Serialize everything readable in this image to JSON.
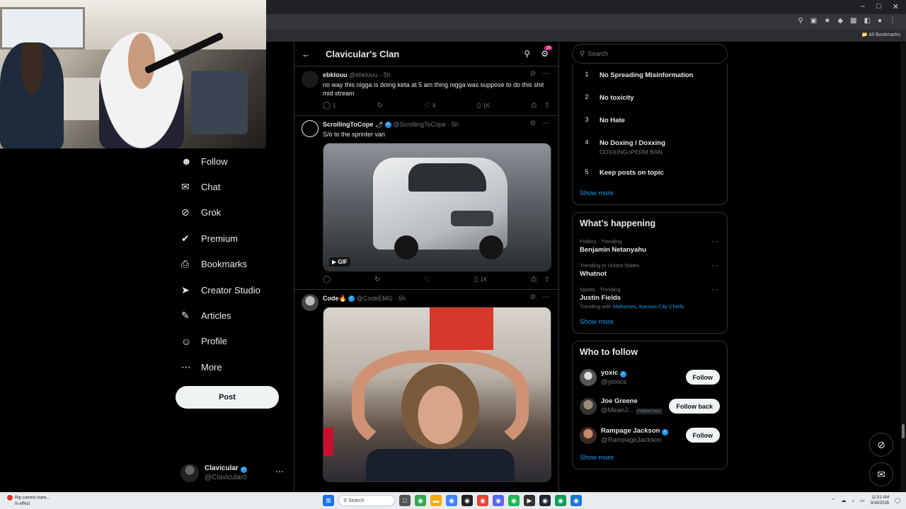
{
  "browser": {
    "bookmarks_all": "All Bookmarks"
  },
  "nav": {
    "items": [
      {
        "label": "Follow",
        "icon": "follow-icon"
      },
      {
        "label": "Chat",
        "icon": "chat-icon"
      },
      {
        "label": "Grok",
        "icon": "grok-icon"
      },
      {
        "label": "Premium",
        "icon": "premium-icon"
      },
      {
        "label": "Bookmarks",
        "icon": "bookmark-icon"
      },
      {
        "label": "Creator Studio",
        "icon": "rocket-icon"
      },
      {
        "label": "Articles",
        "icon": "articles-icon"
      },
      {
        "label": "Profile",
        "icon": "profile-icon"
      },
      {
        "label": "More",
        "icon": "more-circle-icon"
      }
    ],
    "post_label": "Post",
    "account": {
      "name": "Clavicular",
      "handle": "@Clavicular0"
    }
  },
  "community": {
    "title": "Clavicular's Clan",
    "notif_badge": "19"
  },
  "tweets": [
    {
      "name": "ebklouu",
      "handle": "@ebklouu",
      "time": "· 5h",
      "text": "no way this nigga is doing keta at 5 am thing nigga was suppose to do this shit mid stream",
      "replies": "1",
      "likes": "6",
      "views": "1K"
    },
    {
      "name": "ScrollingToCope",
      "emoji": "🌶",
      "handle": "@ScrollingToCope",
      "time": "· 5h",
      "text": "S/o to the sprinter van",
      "media_badge": "GIF",
      "views": "1K"
    },
    {
      "name": "Code",
      "emoji": "🔥",
      "handle": "@CodeEMG",
      "time": "· 5h"
    }
  ],
  "right": {
    "search_placeholder": "Search",
    "rules": [
      {
        "num": "1",
        "title": "No Spreading Misinformation",
        "sub": ""
      },
      {
        "num": "2",
        "title": "No toxicity",
        "sub": ""
      },
      {
        "num": "3",
        "title": "No Hate",
        "sub": ""
      },
      {
        "num": "4",
        "title": "No Doxing / Doxxing",
        "sub": "DOXXING=PERM BAN"
      },
      {
        "num": "5",
        "title": "Keep posts on topic",
        "sub": ""
      }
    ],
    "show_more": "Show more",
    "happening_title": "What’s happening",
    "trends": [
      {
        "context": "Politics · Trending",
        "title": "Benjamin Netanyahu"
      },
      {
        "context": "Trending in United States",
        "title": "Whatnot"
      },
      {
        "context": "Sports · Trending",
        "title": "Justin Fields",
        "with_label": "Trending with",
        "with_links": "Mahomes, Kansas City Chiefs"
      }
    ],
    "wtf_title": "Who to follow",
    "wtf": [
      {
        "name": "yoxic",
        "handle": "@yoxics",
        "button": "Follow"
      },
      {
        "name": "Joe Greene",
        "handle": "@MeanJ...",
        "follows_you": "Follows you",
        "button": "Follow back"
      },
      {
        "name": "Rampage Jackson",
        "handle": "@RampageJackson",
        "button": "Follow"
      }
    ]
  },
  "taskbar": {
    "notif_line1": "Rip current stare...",
    "notif_line2": "In effect",
    "search": "Search",
    "time": "11:51 AM",
    "date": "3/16/2026"
  },
  "colors": {
    "accent": "#1d9bf0",
    "background": "#000000",
    "muted": "#71767b"
  }
}
